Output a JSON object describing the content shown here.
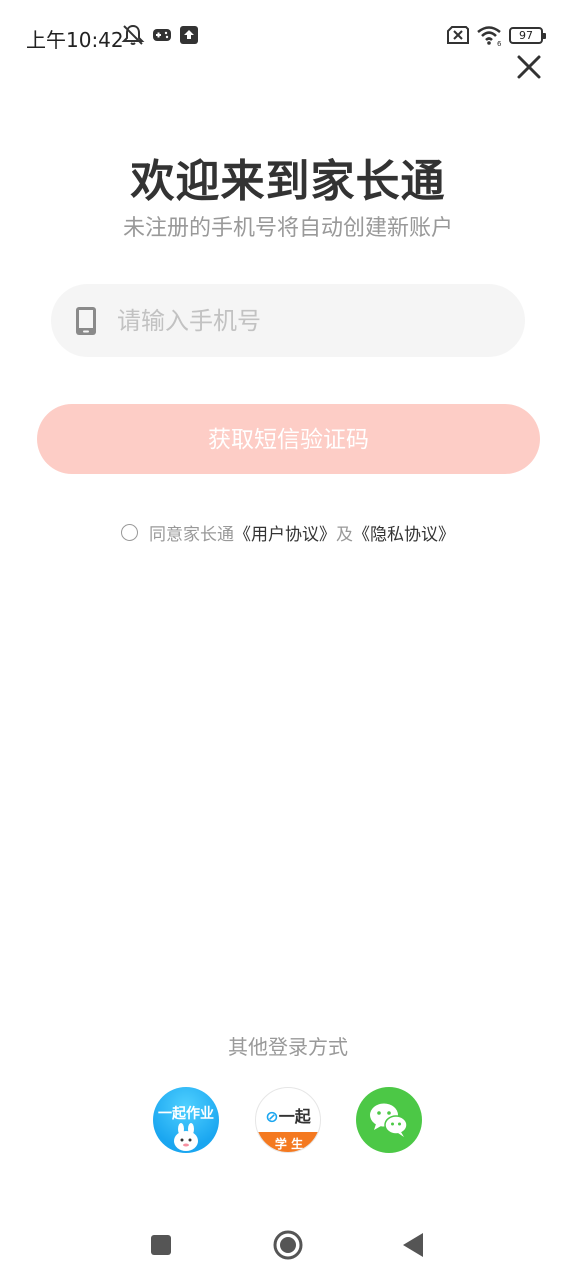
{
  "status_bar": {
    "time": "上午10:42",
    "battery_level": "97",
    "icons": [
      "mute-bell-icon",
      "gamepad-icon",
      "upload-icon",
      "sim-blocked-icon",
      "wifi-icon",
      "battery-icon"
    ]
  },
  "header": {
    "title": "欢迎来到家长通",
    "subtitle": "未注册的手机号将自动创建新账户"
  },
  "phone_input": {
    "placeholder": "请输入手机号",
    "value": ""
  },
  "code_button": {
    "label": "获取短信验证码",
    "color": "#fdcdc6"
  },
  "agreement": {
    "prefix": "同意家长通",
    "user_agreement": "《用户协议》",
    "and": "及",
    "privacy_policy": "《隐私协议》",
    "checked": false
  },
  "other_login": {
    "label": "其他登录方式",
    "options": [
      {
        "name": "一起作业",
        "icon": "yiqi-zuoye-app-icon"
      },
      {
        "name": "一起学生",
        "logo_text": "一起",
        "badge": "学 生",
        "icon": "yiqi-student-app-icon"
      },
      {
        "name": "WeChat",
        "icon": "wechat-icon",
        "color": "#4cc846"
      }
    ]
  },
  "nav_bar": {
    "buttons": [
      "recent-apps-icon",
      "home-icon",
      "back-icon"
    ]
  }
}
